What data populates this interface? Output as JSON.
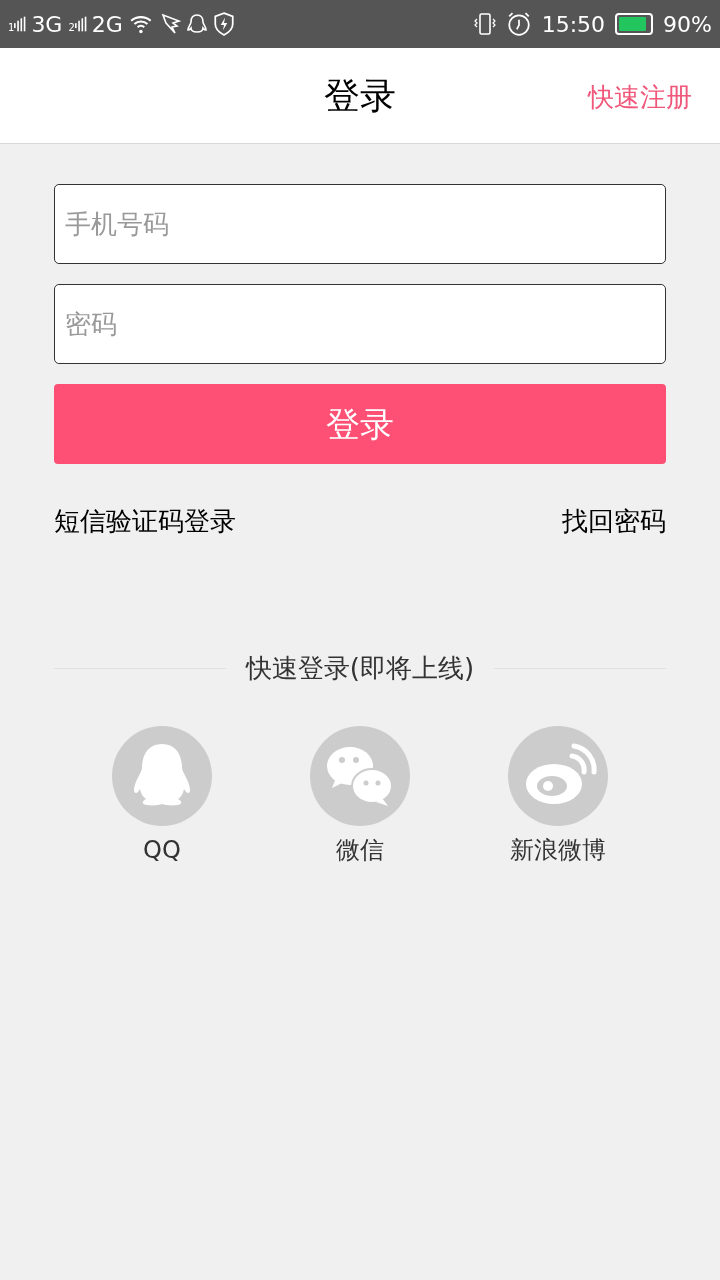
{
  "status_bar": {
    "sims": [
      {
        "index": "1",
        "network": "3G"
      },
      {
        "index": "2",
        "network": "2G"
      }
    ],
    "time": "15:50",
    "battery": {
      "text": "90%"
    }
  },
  "header": {
    "title": "登录",
    "action": "快速注册"
  },
  "form": {
    "phone": {
      "placeholder": "手机号码"
    },
    "password": {
      "placeholder": "密码"
    },
    "submit": "登录"
  },
  "links": {
    "sms_login": "短信验证码登录",
    "forgot_password": "找回密码"
  },
  "quick_login": {
    "title": "快速登录(即将上线)",
    "providers": [
      {
        "kind": "qq",
        "label": "QQ"
      },
      {
        "kind": "wechat",
        "label": "微信"
      },
      {
        "kind": "weibo",
        "label": "新浪微博"
      }
    ]
  }
}
